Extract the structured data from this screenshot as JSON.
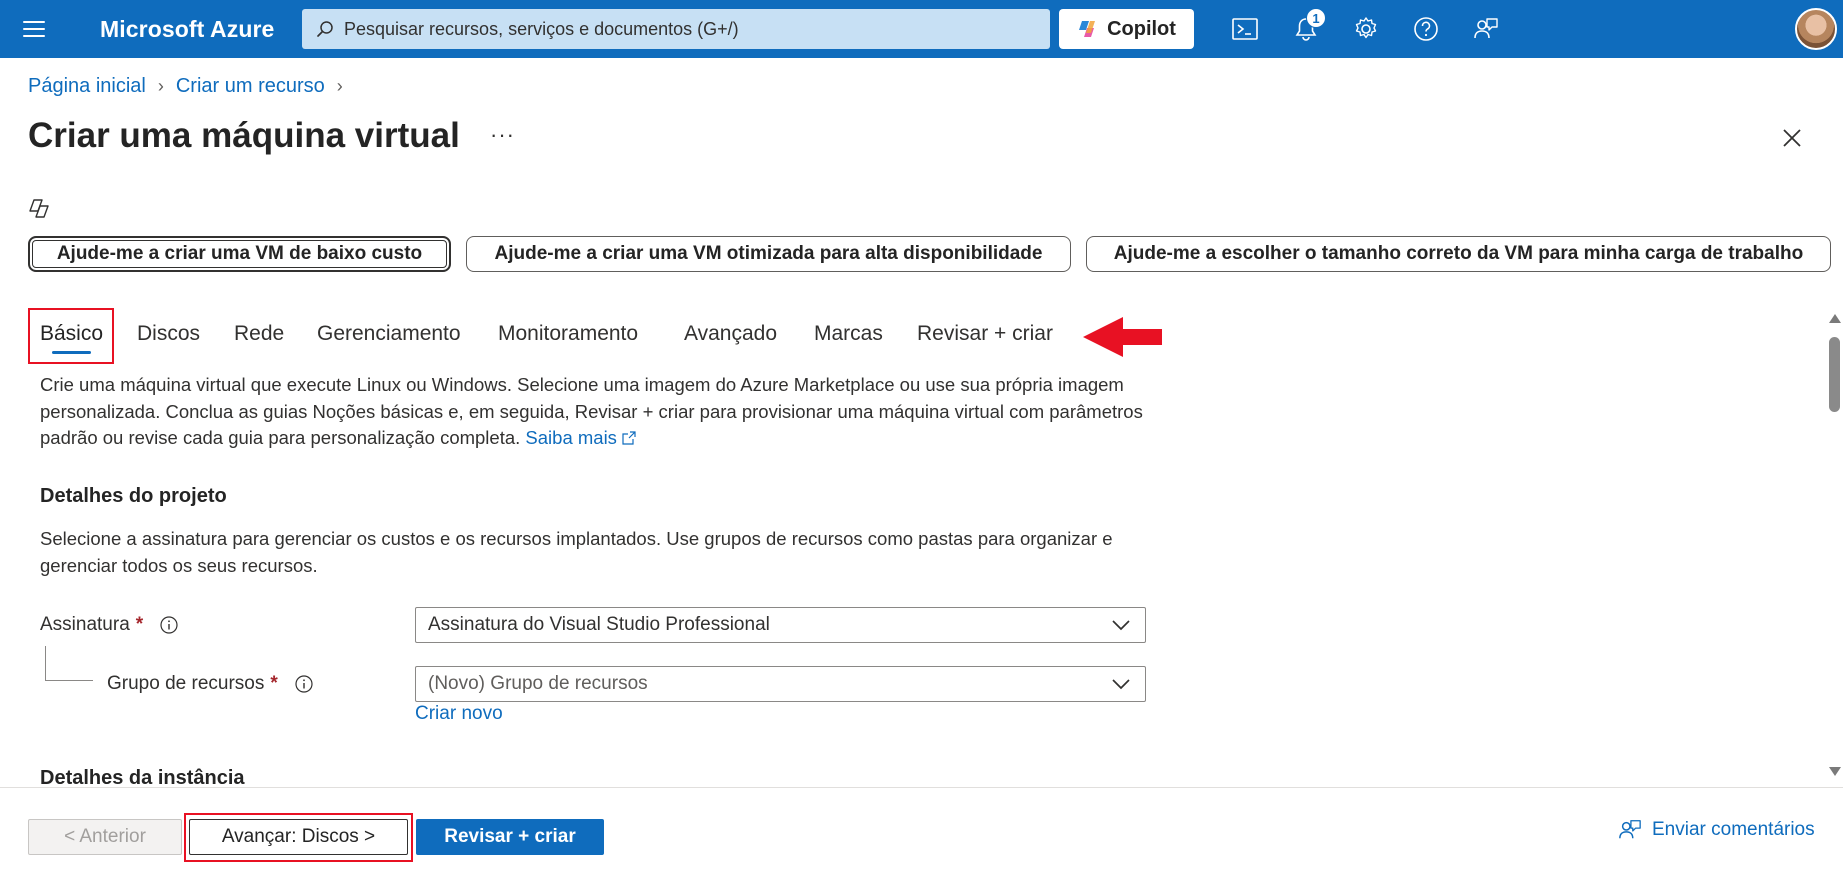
{
  "topbar": {
    "brand": "Microsoft Azure",
    "search_placeholder": "Pesquisar recursos, serviços e documentos (G+/)",
    "copilot_label": "Copilot",
    "notification_count": "1",
    "color": "#0f6cbd"
  },
  "breadcrumb": {
    "items": [
      "Página inicial",
      "Criar um recurso"
    ]
  },
  "page": {
    "title": "Criar uma máquina virtual",
    "more": "···"
  },
  "prompts": [
    "Ajude-me a criar uma VM de baixo custo",
    "Ajude-me a criar uma VM otimizada para alta disponibilidade",
    "Ajude-me a escolher o tamanho correto da VM para minha carga de trabalho"
  ],
  "tabs": [
    "Básico",
    "Discos",
    "Rede",
    "Gerenciamento",
    "Monitoramento",
    "Avançado",
    "Marcas",
    "Revisar + criar"
  ],
  "intro": {
    "text": "Crie uma máquina virtual que execute Linux ou Windows. Selecione uma imagem do Azure Marketplace ou use sua própria imagem personalizada. Conclua as guias Noções básicas e, em seguida, Revisar + criar para provisionar uma máquina virtual com parâmetros padrão ou revise cada guia para personalização completa.",
    "link": "Saiba mais"
  },
  "project": {
    "title": "Detalhes do projeto",
    "description": "Selecione a assinatura para gerenciar os custos e os recursos implantados. Use grupos de recursos como pastas para organizar e gerenciar todos os seus recursos.",
    "subscription_label": "Assinatura",
    "subscription_value": "Assinatura do Visual Studio Professional",
    "resource_group_label": "Grupo de recursos",
    "resource_group_value": "(Novo) Grupo de recursos",
    "create_new": "Criar novo",
    "required_mark": "*"
  },
  "instance": {
    "title": "Detalhes da instância"
  },
  "footer": {
    "prev": "< Anterior",
    "next": "Avançar: Discos >",
    "review": "Revisar + criar",
    "feedback": "Enviar comentários"
  }
}
